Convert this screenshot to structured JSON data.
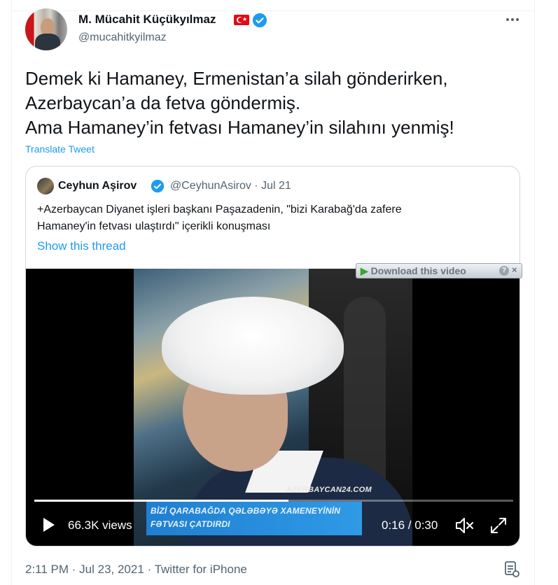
{
  "author": {
    "name": "M. Mücahit Küçükyılmaz",
    "handle": "@mucahitkyilmaz",
    "flag_icon": "turkey-flag-icon",
    "verified_icon": "verified-badge-icon"
  },
  "tweet": {
    "lines": [
      "Demek ki Hamaney, Ermenistan’a silah gönderirken,",
      "Azerbaycan’a da fetva göndermiş.",
      "Ama Hamaney’in fetvası Hamaney’in silahını yenmiş!"
    ],
    "translate_label": "Translate Tweet",
    "footer": "2:11 PM · Jul 23, 2021 · Twitter for iPhone"
  },
  "quote": {
    "name": "Ceyhun Aşirov",
    "meta": "@CeyhunAsirov · Jul 21",
    "lines": [
      "+Azerbaycan Diyanet işleri başkanı Paşazadenin, \"bizi Karabağ'da zafere",
      "Hamaney'in fetvası ulaştırdı\" içerikli konuşması"
    ],
    "show_thread": "Show this thread"
  },
  "video": {
    "download_label": "Download this video",
    "download_help": "?",
    "download_close": "×",
    "watermark": "AZERBAYCAN24.COM",
    "banner_lines": [
      "BİZİ QARABAĞDA QƏLƏBƏYƏ XAMENEYİNİN",
      "FƏTVASI ÇATDIRDI"
    ],
    "views": "66.3K views",
    "time": "0:16 / 0:30",
    "progress_fraction": 0.53
  },
  "colors": {
    "accent": "#1d9bf0",
    "text": "#0f1419",
    "secondary": "#536471",
    "border": "#cfd9de"
  }
}
